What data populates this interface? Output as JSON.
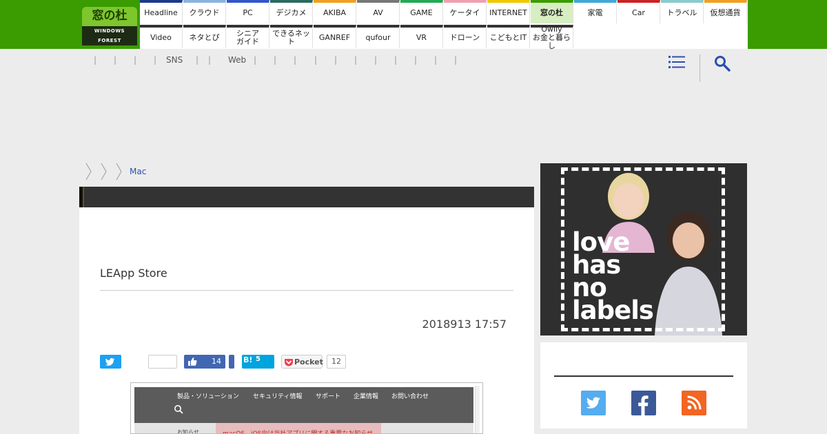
{
  "logo": {
    "text_jp": "窓の杜",
    "text_en": "WINDOWS FOREST"
  },
  "nav": {
    "row1": [
      {
        "label": "Headline",
        "color": "#1a3a8a"
      },
      {
        "label": "クラウド",
        "color": "#8ab4e0"
      },
      {
        "label": "PC",
        "color": "#3355cc"
      },
      {
        "label": "デジカメ",
        "color": "#2b6b5f"
      },
      {
        "label": "AKIBA",
        "color": "#f0a020"
      },
      {
        "label": "AV",
        "color": "#777777"
      },
      {
        "label": "GAME",
        "color": "#22aa55"
      },
      {
        "label": "ケータイ",
        "color": "#f0a0b0"
      },
      {
        "label": "INTERNET",
        "color": "#f0c800"
      },
      {
        "label": "窓の杜",
        "color": "#3a9c00",
        "active": true
      },
      {
        "label": "家電",
        "color": "#40a8d8"
      },
      {
        "label": "Car",
        "color": "#cc2222"
      },
      {
        "label": "トラベル",
        "color": "#88cccc"
      },
      {
        "label": "仮想通貨",
        "color": "#f0a020"
      }
    ],
    "row2": [
      {
        "label": "Video"
      },
      {
        "label": "ネタとぴ"
      },
      {
        "label": "シニア\nガイド"
      },
      {
        "label": "できるネット"
      },
      {
        "label": "GANREF"
      },
      {
        "label": "qufour"
      },
      {
        "label": "VR"
      },
      {
        "label": "ドローン"
      },
      {
        "label": "こどもとIT"
      },
      {
        "label": "Owlly\nお金と暮らし"
      }
    ]
  },
  "subnav": {
    "items": [
      "|",
      "|",
      "|",
      "|",
      "SNS",
      "|",
      "|",
      "Web",
      "|",
      "|",
      "|",
      "|",
      "|",
      "|",
      "|",
      "|",
      "|",
      "|",
      "|"
    ]
  },
  "breadcrumb": {
    "last": "Mac"
  },
  "article": {
    "headline": "LEApp Store",
    "date": "2018913 17:57",
    "share": {
      "facebook_count": "14",
      "hatena_label": "B!",
      "hatena_count": "5",
      "pocket_label": "Pocket",
      "pocket_count": "12"
    },
    "screenshot": {
      "menu": [
        "製品・ソリューション",
        "セキュリティ情報",
        "サポート",
        "企業情報",
        "お問い合わせ"
      ],
      "notice_label": "お知らせ",
      "notice_text": "macOS、iOS向け当社アプリに関する重要なお知らせ"
    }
  },
  "sidebar": {
    "ad_text": "love\nhas\nno\nlabels"
  },
  "colors": {
    "header_green": "#3a9c00",
    "link_blue": "#2a4fb0"
  }
}
